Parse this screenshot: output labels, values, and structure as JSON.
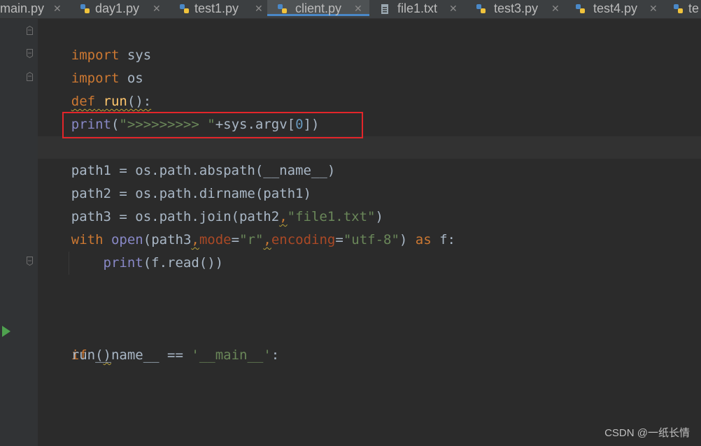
{
  "tabs": [
    {
      "label": "main.py",
      "active": false
    },
    {
      "label": "day1.py",
      "active": false
    },
    {
      "label": "test1.py",
      "active": false
    },
    {
      "label": "client.py",
      "active": true
    },
    {
      "label": "file1.txt",
      "active": false
    },
    {
      "label": "test3.py",
      "active": false
    },
    {
      "label": "test4.py",
      "active": false
    },
    {
      "label": "te",
      "active": false
    }
  ],
  "tab_close_glyph": "✕",
  "code": {
    "l1": {
      "kw": "import",
      "rest": " sys"
    },
    "l2": {
      "kw": "import",
      "rest": " os"
    },
    "l3": {
      "kw": "def",
      "name": "run",
      "rest": "():"
    },
    "l4": {
      "fn": "print",
      "open": "(",
      "str": "\">>>>>>>>> \"",
      "plus": "+sys.argv[",
      "num": "0",
      "close": "])"
    },
    "l5": {
      "text": "path1 = os.path.abspath(__name__)"
    },
    "l6": {
      "text": "path2 = os.path.dirname(path1)"
    },
    "l7": {
      "a": "path3 = os.path.join(path2",
      "comma": ",",
      "str": "\"file1.txt\"",
      "close": ")"
    },
    "l8": {
      "kw": "with",
      "bi": "open",
      "a": "(path3",
      "c1": ",",
      "p1": "mode",
      "eq1": "=",
      "s1": "\"r\"",
      "c2": ",",
      "p2": "encoding",
      "eq2": "=",
      "s2": "\"utf-8\"",
      "close": ") ",
      "kw2": "as",
      "f": " f:"
    },
    "l9": {
      "bi": "print",
      "rest": "(f.read())"
    },
    "l10": {
      "kw": "if",
      "a": " __name__ == ",
      "str": "'__main__'",
      "colon": ":"
    },
    "l11": {
      "name": "run",
      "open": "(",
      "close": ")"
    }
  },
  "watermark": "CSDN @一纸长情",
  "colors": {
    "background": "#2b2b2b",
    "keyword": "#cc7832",
    "string": "#6a8759",
    "number": "#6897bb",
    "builtin": "#8888c6",
    "function": "#ffc66d",
    "highlight_box": "#e3252a"
  },
  "icons": {
    "python_file": "python-file-icon",
    "text_file": "text-file-icon",
    "run": "run-triangle-icon",
    "fold": "fold-marker-icon"
  }
}
